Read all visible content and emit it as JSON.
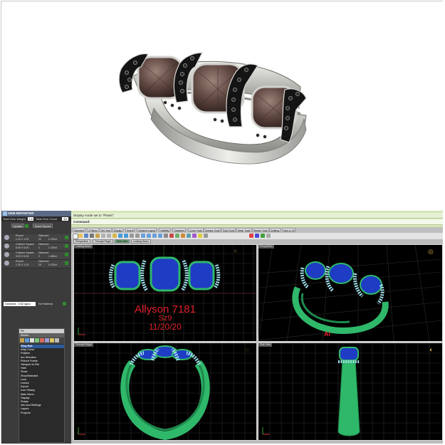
{
  "gem_reporter": {
    "title": "GEM REPORTER",
    "total_gem_weight_label": "Total Gem Weight",
    "total_gem_weight_value": "1.8",
    "total_gem_count_label": "Total Gem Count",
    "total_gem_count_value": "45",
    "update_label": "Update",
    "save_report_label": "Save Report",
    "rows": [
      {
        "shape": "Round",
        "size": "1.20 X 1.20",
        "material": "Diamond",
        "count": "22",
        "weight": "0.100ct"
      },
      {
        "shape": "Cushion Square",
        "size": "6.00 X 6.00",
        "material": "Diamond",
        "count": "1",
        "weight": "1.100ct"
      },
      {
        "shape": "Cushion Square",
        "size": "5.00 X 5.00",
        "material": "Diamond",
        "count": "2",
        "weight": "1.469ct"
      },
      {
        "shape": "Round",
        "size": "1.20 X 1.20",
        "material": "Diamond",
        "count": "20",
        "weight": "0.120ct"
      }
    ],
    "material_select": "Diamond - 3.52 sg/cc",
    "set_material_label": "Set Material"
  },
  "plugins": {
    "header": "F6",
    "subheader": "Modes",
    "items": [
      {
        "label": "Ring Rail",
        "selected": true
      },
      {
        "label": "Inlay Curve"
      },
      {
        "label": "Polyline"
      },
      {
        "label": "Arc Direction"
      },
      {
        "label": "Picture Frame"
      },
      {
        "label": "Viewport to File"
      },
      {
        "label": "Hide"
      },
      {
        "label": "Show"
      },
      {
        "label": "ShowSelected"
      },
      {
        "label": "Lock"
      },
      {
        "label": "Unlock"
      },
      {
        "label": "Export"
      },
      {
        "label": "Icon History"
      },
      {
        "label": "Main Menu"
      },
      {
        "label": "Display"
      },
      {
        "label": "Snaps"
      },
      {
        "label": "Info and Settings"
      },
      {
        "label": "Layers"
      },
      {
        "label": "Projects"
      }
    ]
  },
  "command": {
    "history": "Display mode set to \"Plastic\"",
    "prompt": "Command:"
  },
  "toolbar_tabs": [
    "Standard",
    "CPlanes",
    "Set View",
    "Display",
    "Select",
    "Viewport Layout",
    "Visibility",
    "Transform",
    "Curve Tools",
    "Surface Tools",
    "Solid Tools",
    "Mesh Tools",
    "Render Tools",
    "Drafting",
    "New in V5"
  ],
  "viewport_tabs": [
    "Perspective",
    "Through Finger",
    "Side View",
    "Looking Down"
  ],
  "viewports": {
    "top_left": "Looking Down",
    "top_right": "Perspective",
    "bottom_left": "Through Finger",
    "bottom_right": "Side View"
  },
  "engraving": {
    "line1": "Allyson 7181",
    "line2": "Sz9",
    "line3": "11/20/20"
  },
  "colors": {
    "ring_green": "#2fb86a",
    "gem_blue": "#1f3cc4",
    "accent_diamond": "#9fdce8",
    "grid": "#2c2c2c",
    "text_red": "#e0202a"
  }
}
